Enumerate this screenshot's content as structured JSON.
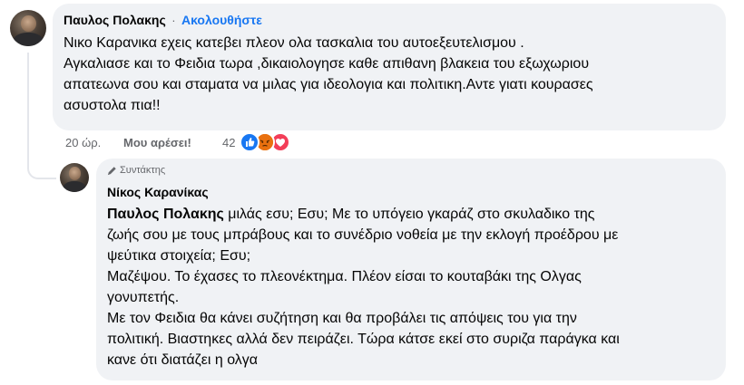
{
  "comment": {
    "author": "Παυλος Πολακης",
    "separator": "·",
    "follow_label": "Ακολουθήστε",
    "lines": [
      "Νικο Καρανικα εχεις κατεβει πλεον ολα τασκαλια του αυτοεξευτελισμου .",
      "Αγκαλιασε και το Φειδια τωρα ,δικαιολογησε καθε απιθανη βλακεια του εξωχωριου",
      "απατεωνα σου και σταματα να μιλας για ιδεολογια και πολιτικη.Αντε γιατι κουρασες",
      "ασυστολα πια!!"
    ],
    "time": "20 ώρ.",
    "like_label": "Μου αρέσει!",
    "reaction_count": "42",
    "reactions": [
      "like-icon",
      "angry-icon",
      "love-icon"
    ],
    "colors": {
      "like": "#1877f2",
      "angry": "#e9710f",
      "love": "#f33e58"
    }
  },
  "reply": {
    "badge_icon": "pencil-icon",
    "badge": "Συντάκτης",
    "author": "Νίκος Καρανίκας",
    "mention": "Παυλος Πολακης",
    "first_line_rest": " μιλάς εσυ; Εσυ; Με το υπόγειο γκαράζ στο σκυλαδικο της",
    "lines": [
      "ζωής σου με τους μπράβους και το συνέδριο νοθεία με την εκλογή προέδρου με",
      "ψεύτικα στοιχεία; Εσυ;",
      "Μαζέψου. Το έχασες το πλεονέκτημα. Πλέον είσαι το κουταβάκι της Ολγας",
      "γονυπετής.",
      "Με τον Φειδια θα κάνει συζήτηση και θα προβάλει τις απόψεις του για την",
      "πολιτική. Βιαστηκες αλλά δεν πειράζει. Τώρα κάτσε εκεί στο συριζα παράγκα και",
      "κανε ότι διατάζει η ολγα"
    ]
  }
}
